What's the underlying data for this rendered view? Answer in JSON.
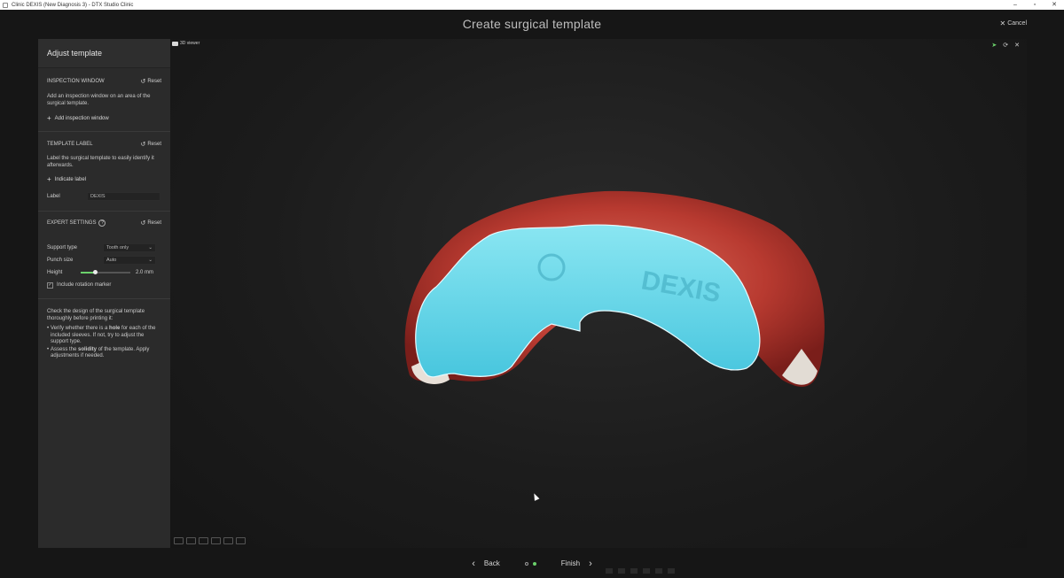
{
  "window": {
    "title": "Clinic DEXIS (New Diagnosis 3) - DTX Studio Clinic",
    "minimize": "–",
    "maximize": "▫",
    "close": "✕"
  },
  "modal": {
    "title": "Create surgical template",
    "cancel_label": "Cancel"
  },
  "panel": {
    "header": "Adjust template",
    "inspection": {
      "title": "INSPECTION WINDOW",
      "reset": "Reset",
      "description": "Add an inspection window on an area of the surgical template.",
      "add_link": "Add inspection window"
    },
    "label_section": {
      "title": "TEMPLATE LABEL",
      "reset": "Reset",
      "description": "Label the surgical template to easily identify it afterwards.",
      "add_link": "Indicate label",
      "field_label": "Label",
      "field_value": "DEXIS"
    },
    "expert": {
      "title": "EXPERT SETTINGS",
      "reset": "Reset",
      "support_type_label": "Support type",
      "support_type_value": "Tooth only",
      "punch_size_label": "Punch size",
      "punch_size_value": "Auto",
      "height_label": "Height",
      "height_value": "2.0 mm",
      "height_fraction": 0.3,
      "rotation_marker_label": "Include rotation marker",
      "rotation_marker_checked": true
    },
    "check": {
      "intro": "Check the design of the surgical template thoroughly before printing it:",
      "tip1_a": "Verify whether there is a ",
      "tip1_b": "hole",
      "tip1_c": " for each of the included sleeves. If not, try to adjust the support type.",
      "tip2_a": "Assess the ",
      "tip2_b": "solidity",
      "tip2_c": " of the template. Apply adjustments if needed."
    }
  },
  "viewer": {
    "label": "3D viewer",
    "template_text": "DEXIS"
  },
  "footer": {
    "back_label": "Back",
    "finish_label": "Finish"
  },
  "colors": {
    "accent_green": "#6bd16b",
    "template_blue": "#5fd3e8",
    "gum_red": "#b03a30"
  }
}
